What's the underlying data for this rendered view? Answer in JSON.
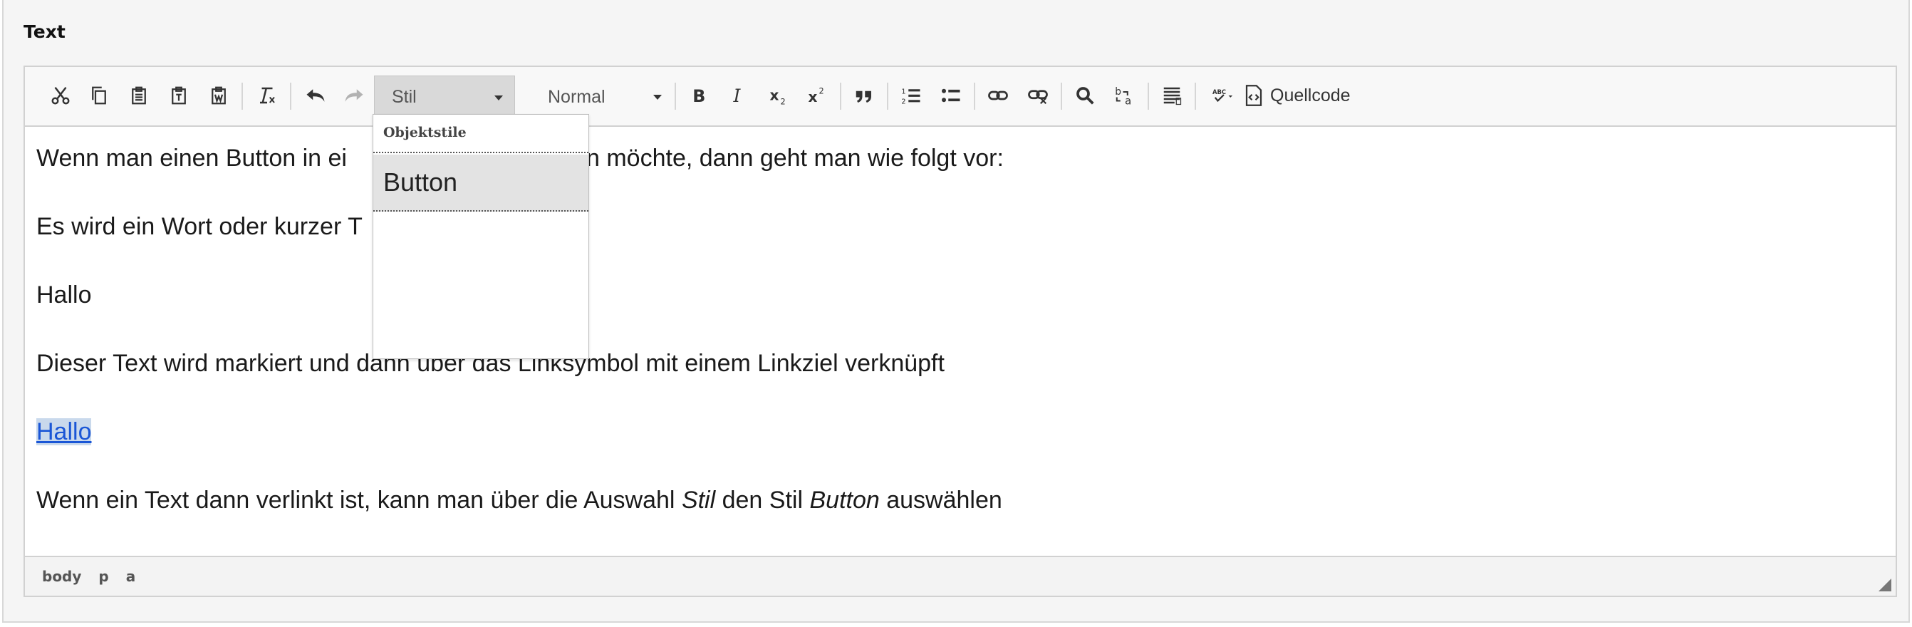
{
  "field": {
    "label": "Text"
  },
  "toolbar": {
    "style_combo": "Stil",
    "format_combo": "Normal",
    "source_label": "Quellcode",
    "icons": [
      "cut-icon",
      "copy-icon",
      "paste-icon",
      "paste-text-icon",
      "paste-word-icon",
      "remove-format-icon",
      "undo-icon",
      "redo-icon",
      "bold-icon",
      "italic-icon",
      "subscript-icon",
      "superscript-icon",
      "blockquote-icon",
      "numbered-list-icon",
      "bulleted-list-icon",
      "link-icon",
      "unlink-icon",
      "find-icon",
      "replace-icon",
      "show-blocks-icon",
      "spellcheck-icon",
      "source-icon"
    ]
  },
  "dropdown": {
    "heading": "Objektstile",
    "items": [
      "Button"
    ]
  },
  "content": {
    "p1": "Wenn man einen Button in ei",
    "p1_end": "n möchte, dann geht man wie folgt vor:",
    "p2": "Es wird ein Wort oder kurzer T",
    "p3": "Hallo",
    "p4": "Dieser Text wird markiert und dann über das Linksymbol mit einem Linkziel verknüpft",
    "p5_link": "Hallo",
    "p6_a": "Wenn ein Text dann verlinkt ist, kann man über die Auswahl ",
    "p6_b": "Stil",
    "p6_c": " den Stil ",
    "p6_d": "Button",
    "p6_e": " auswählen"
  },
  "statusbar": {
    "path": [
      "body",
      "p",
      "a"
    ]
  },
  "colors": {
    "link": "#1a56d6",
    "selection": "#c9d9ec",
    "active_combo": "#d9d9d9"
  }
}
